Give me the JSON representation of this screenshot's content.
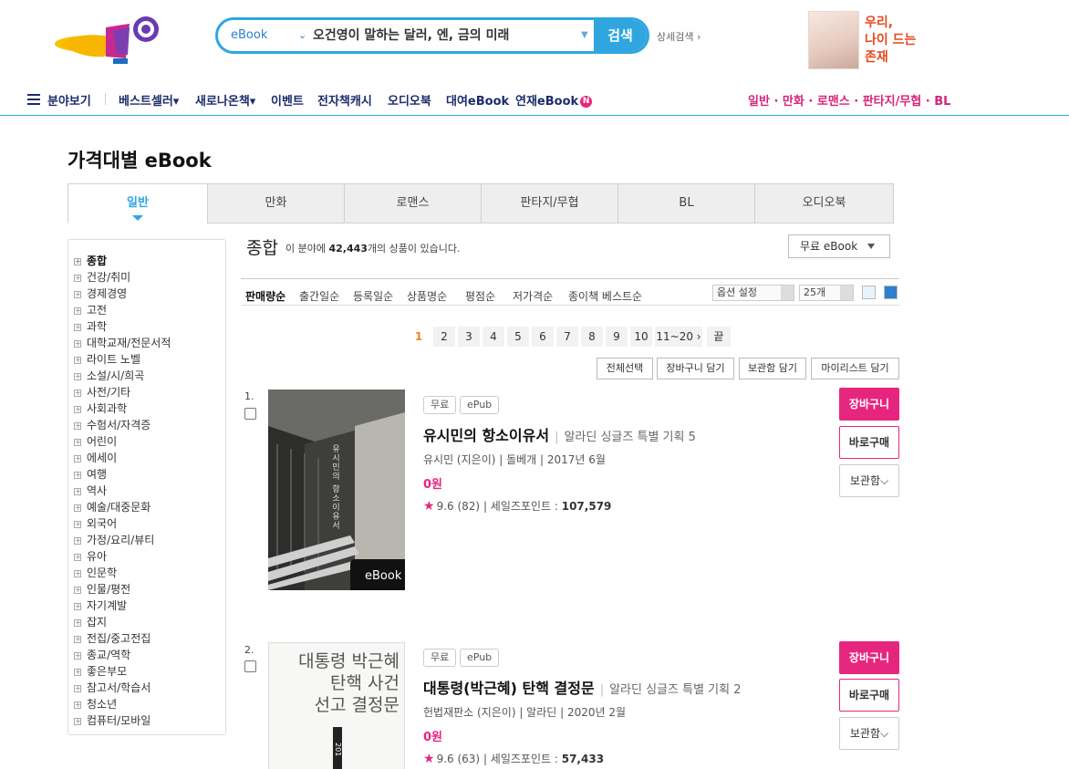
{
  "header": {
    "search": {
      "category": "eBook",
      "query": "오건영이 말하는 달러, 엔, 금의 미래",
      "button": "검색",
      "detail": "상세검색 ›"
    },
    "promo": {
      "text_lines": [
        "우리,",
        "나이 드는",
        "존재"
      ]
    },
    "nav": {
      "menu": "분야보기",
      "items": [
        "베스트셀러▾",
        "새로나온책▾",
        "이벤트",
        "전자책캐시",
        "오디오북",
        "대여eBook",
        "연재eBook"
      ],
      "new_badge": "N",
      "genres": "일반 · 만화 · 로맨스 · 판타지/무협 · BL"
    }
  },
  "page_title": "가격대별 eBook",
  "tabs": [
    "일반",
    "만화",
    "로맨스",
    "판타지/무협",
    "BL",
    "오디오북"
  ],
  "sidebar": {
    "categories": [
      "종합",
      "건강/취미",
      "경제경영",
      "고전",
      "과학",
      "대학교재/전문서적",
      "라이트 노벨",
      "소설/시/희곡",
      "사전/기타",
      "사회과학",
      "수험서/자격증",
      "어린이",
      "에세이",
      "여행",
      "역사",
      "예술/대중문화",
      "외국어",
      "가정/요리/뷰티",
      "유아",
      "인문학",
      "인물/평전",
      "자기계발",
      "잡지",
      "전집/중고전집",
      "종교/역학",
      "좋은부모",
      "참고서/학습서",
      "청소년",
      "컴퓨터/모바일"
    ]
  },
  "section": {
    "title": "종합",
    "count_pre": "이 분야에",
    "count": "42,443",
    "count_post": "개의 상품이 있습니다.",
    "filter": "무료 eBook"
  },
  "sorts": [
    "판매량순",
    "출간일순",
    "등록일순",
    "상품명순",
    "평점순",
    "저가격순",
    "종이책 베스트순"
  ],
  "options": {
    "setting": "옵션 설정",
    "per_page": "25개"
  },
  "pager": [
    "1",
    "2",
    "3",
    "4",
    "5",
    "6",
    "7",
    "8",
    "9",
    "10",
    "11~20 ›",
    "끝"
  ],
  "tools": [
    "전체선택",
    "장바구니 담기",
    "보관함 담기",
    "마이리스트 담기"
  ],
  "items": [
    {
      "num": "1.",
      "tags": [
        "무료",
        "ePub"
      ],
      "title": "유시민의 항소이유서",
      "series": "알라딘 싱글즈 특별 기획 5",
      "meta": "유시민 (지은이) | 돌베개 | 2017년 6월",
      "price": "0원",
      "rating": "9.6",
      "reviews": "(82)",
      "points_label": "세일즈포인트 :",
      "points": "107,579",
      "cover_text": "유시민의 항소이유서",
      "badge": "eBook"
    },
    {
      "num": "2.",
      "tags": [
        "무료",
        "ePub"
      ],
      "title": "대통령(박근혜) 탄핵 결정문",
      "series": "알라딘 싱글즈 특별 기획 2",
      "meta": "헌법재판소 (지은이) | 알라딘 | 2020년 2월",
      "price": "0원",
      "rating": "9.6",
      "reviews": "(63)",
      "points_label": "세일즈포인트 :",
      "points": "57,433",
      "cover_lines": [
        "대통령 박근혜",
        "탄핵 사건",
        "선고 결정문"
      ],
      "cover_year": "201"
    }
  ],
  "buttons": {
    "cart": "장바구니",
    "buy": "바로구매",
    "keep": "보관함"
  },
  "colors": {
    "accent_blue": "#2fa6e0",
    "accent_pink": "#e6267e",
    "nav_navy": "#1b2c6b",
    "page_orange": "#f58220"
  }
}
